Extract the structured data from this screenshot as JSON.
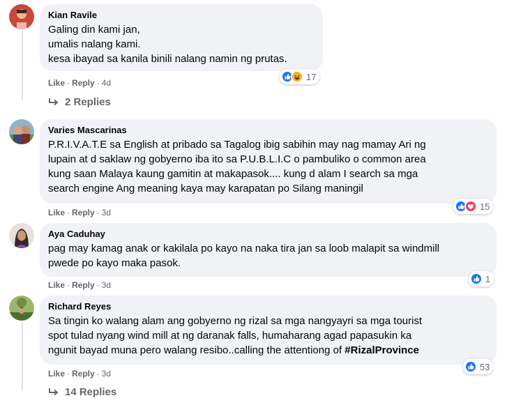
{
  "comments": [
    {
      "author": "Kian Ravile",
      "text": "Galing din kami jan,\numalis nalang kami.\nkesa ibayad sa kanila binili nalang namin ng prutas.",
      "reaction_count": "17",
      "reaction_icons": [
        "like-icon",
        "haha-icon"
      ],
      "like": "Like",
      "reply": "Reply",
      "time": "4d",
      "replies_label": "2 Replies"
    },
    {
      "author": "Varies Mascarinas",
      "text": "P.R.I.V.A.T.E sa English at pribado sa Tagalog ibig sabihin may nag mamay Ari ng\nlupain at d saklaw ng gobyerno iba ito sa P.U.B.L.I.C o pambuliko o common area\nkung saan Malaya kaung gamitin at makapasok.... kung d alam I search sa mga\nsearch engine Ang meaning kaya may karapatan po Silang maningil",
      "reaction_count": "15",
      "reaction_icons": [
        "like-icon",
        "love-icon"
      ],
      "like": "Like",
      "reply": "Reply",
      "time": "3d"
    },
    {
      "author": "Aya Caduhay",
      "text": "pag may kamag anak or kakilala po kayo na naka tira jan sa loob malapit sa windmill\npwede po kayo maka pasok.",
      "reaction_count": "1",
      "reaction_icons": [
        "like-icon"
      ],
      "like": "Like",
      "reply": "Reply",
      "time": "3d"
    },
    {
      "author": "Richard Reyes",
      "text": "Sa tingin ko walang alam ang gobyerno ng rizal sa mga nangyayri sa mga tourist\nspot tulad nyang wind mill at ng daranak falls, humaharang agad papasukin ka\nngunit bayad muna pero walang resibo..calling the attentiong of ",
      "hashtag": "#RizalProvince",
      "reaction_count": "53",
      "reaction_icons": [
        "like-icon"
      ],
      "like": "Like",
      "reply": "Reply",
      "time": "3d",
      "replies_label": "14 Replies"
    }
  ],
  "colors": {
    "bubble": "#f0f2f5",
    "meta": "#65676b",
    "like": "#1877f2",
    "love": "#f33e58",
    "haha": "#f7b125"
  }
}
